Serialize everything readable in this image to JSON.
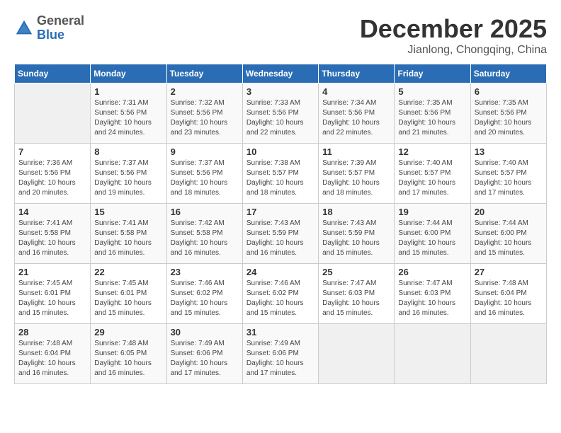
{
  "header": {
    "logo_line1": "General",
    "logo_line2": "Blue",
    "month_title": "December 2025",
    "location": "Jianlong, Chongqing, China"
  },
  "days_of_week": [
    "Sunday",
    "Monday",
    "Tuesday",
    "Wednesday",
    "Thursday",
    "Friday",
    "Saturday"
  ],
  "weeks": [
    [
      {
        "day": "",
        "info": ""
      },
      {
        "day": "1",
        "info": "Sunrise: 7:31 AM\nSunset: 5:56 PM\nDaylight: 10 hours\nand 24 minutes."
      },
      {
        "day": "2",
        "info": "Sunrise: 7:32 AM\nSunset: 5:56 PM\nDaylight: 10 hours\nand 23 minutes."
      },
      {
        "day": "3",
        "info": "Sunrise: 7:33 AM\nSunset: 5:56 PM\nDaylight: 10 hours\nand 22 minutes."
      },
      {
        "day": "4",
        "info": "Sunrise: 7:34 AM\nSunset: 5:56 PM\nDaylight: 10 hours\nand 22 minutes."
      },
      {
        "day": "5",
        "info": "Sunrise: 7:35 AM\nSunset: 5:56 PM\nDaylight: 10 hours\nand 21 minutes."
      },
      {
        "day": "6",
        "info": "Sunrise: 7:35 AM\nSunset: 5:56 PM\nDaylight: 10 hours\nand 20 minutes."
      }
    ],
    [
      {
        "day": "7",
        "info": "Sunrise: 7:36 AM\nSunset: 5:56 PM\nDaylight: 10 hours\nand 20 minutes."
      },
      {
        "day": "8",
        "info": "Sunrise: 7:37 AM\nSunset: 5:56 PM\nDaylight: 10 hours\nand 19 minutes."
      },
      {
        "day": "9",
        "info": "Sunrise: 7:37 AM\nSunset: 5:56 PM\nDaylight: 10 hours\nand 18 minutes."
      },
      {
        "day": "10",
        "info": "Sunrise: 7:38 AM\nSunset: 5:57 PM\nDaylight: 10 hours\nand 18 minutes."
      },
      {
        "day": "11",
        "info": "Sunrise: 7:39 AM\nSunset: 5:57 PM\nDaylight: 10 hours\nand 18 minutes."
      },
      {
        "day": "12",
        "info": "Sunrise: 7:40 AM\nSunset: 5:57 PM\nDaylight: 10 hours\nand 17 minutes."
      },
      {
        "day": "13",
        "info": "Sunrise: 7:40 AM\nSunset: 5:57 PM\nDaylight: 10 hours\nand 17 minutes."
      }
    ],
    [
      {
        "day": "14",
        "info": "Sunrise: 7:41 AM\nSunset: 5:58 PM\nDaylight: 10 hours\nand 16 minutes."
      },
      {
        "day": "15",
        "info": "Sunrise: 7:41 AM\nSunset: 5:58 PM\nDaylight: 10 hours\nand 16 minutes."
      },
      {
        "day": "16",
        "info": "Sunrise: 7:42 AM\nSunset: 5:58 PM\nDaylight: 10 hours\nand 16 minutes."
      },
      {
        "day": "17",
        "info": "Sunrise: 7:43 AM\nSunset: 5:59 PM\nDaylight: 10 hours\nand 16 minutes."
      },
      {
        "day": "18",
        "info": "Sunrise: 7:43 AM\nSunset: 5:59 PM\nDaylight: 10 hours\nand 15 minutes."
      },
      {
        "day": "19",
        "info": "Sunrise: 7:44 AM\nSunset: 6:00 PM\nDaylight: 10 hours\nand 15 minutes."
      },
      {
        "day": "20",
        "info": "Sunrise: 7:44 AM\nSunset: 6:00 PM\nDaylight: 10 hours\nand 15 minutes."
      }
    ],
    [
      {
        "day": "21",
        "info": "Sunrise: 7:45 AM\nSunset: 6:01 PM\nDaylight: 10 hours\nand 15 minutes."
      },
      {
        "day": "22",
        "info": "Sunrise: 7:45 AM\nSunset: 6:01 PM\nDaylight: 10 hours\nand 15 minutes."
      },
      {
        "day": "23",
        "info": "Sunrise: 7:46 AM\nSunset: 6:02 PM\nDaylight: 10 hours\nand 15 minutes."
      },
      {
        "day": "24",
        "info": "Sunrise: 7:46 AM\nSunset: 6:02 PM\nDaylight: 10 hours\nand 15 minutes."
      },
      {
        "day": "25",
        "info": "Sunrise: 7:47 AM\nSunset: 6:03 PM\nDaylight: 10 hours\nand 15 minutes."
      },
      {
        "day": "26",
        "info": "Sunrise: 7:47 AM\nSunset: 6:03 PM\nDaylight: 10 hours\nand 16 minutes."
      },
      {
        "day": "27",
        "info": "Sunrise: 7:48 AM\nSunset: 6:04 PM\nDaylight: 10 hours\nand 16 minutes."
      }
    ],
    [
      {
        "day": "28",
        "info": "Sunrise: 7:48 AM\nSunset: 6:04 PM\nDaylight: 10 hours\nand 16 minutes."
      },
      {
        "day": "29",
        "info": "Sunrise: 7:48 AM\nSunset: 6:05 PM\nDaylight: 10 hours\nand 16 minutes."
      },
      {
        "day": "30",
        "info": "Sunrise: 7:49 AM\nSunset: 6:06 PM\nDaylight: 10 hours\nand 17 minutes."
      },
      {
        "day": "31",
        "info": "Sunrise: 7:49 AM\nSunset: 6:06 PM\nDaylight: 10 hours\nand 17 minutes."
      },
      {
        "day": "",
        "info": ""
      },
      {
        "day": "",
        "info": ""
      },
      {
        "day": "",
        "info": ""
      }
    ]
  ]
}
